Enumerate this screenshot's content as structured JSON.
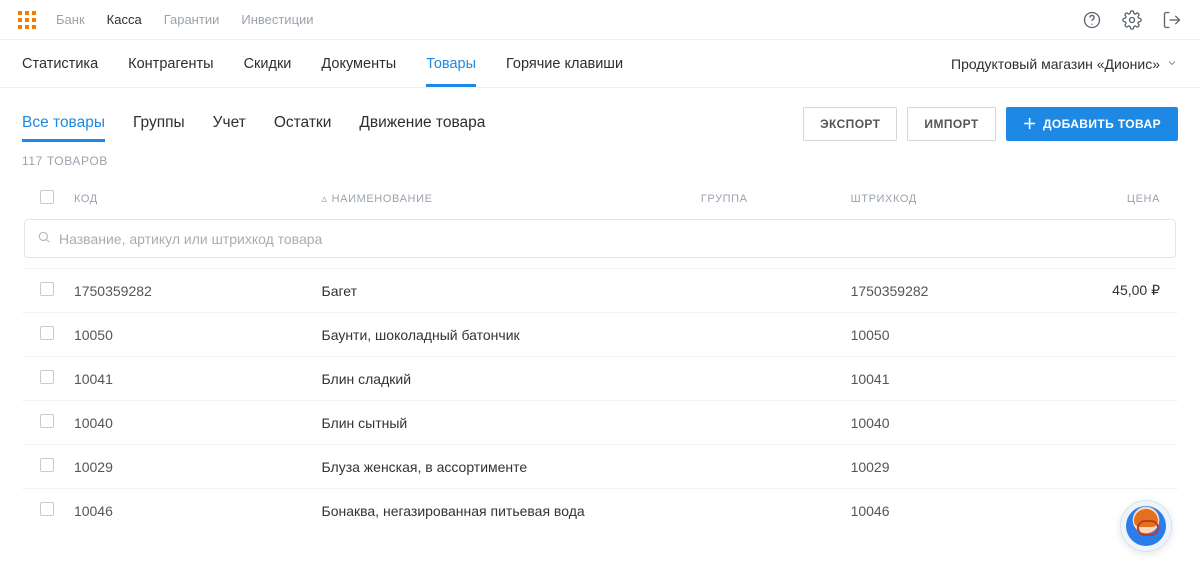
{
  "top_nav": {
    "items": [
      "Банк",
      "Касса",
      "Гарантии",
      "Инвестиции"
    ],
    "active_index": 1
  },
  "sub_nav": {
    "items": [
      "Статистика",
      "Контрагенты",
      "Скидки",
      "Документы",
      "Товары",
      "Горячие клавиши"
    ],
    "active_index": 4
  },
  "store_selector": {
    "label": "Продуктовый магазин «Дионис»"
  },
  "inner_tabs": {
    "items": [
      "Все товары",
      "Группы",
      "Учет",
      "Остатки",
      "Движение товара"
    ],
    "active_index": 0
  },
  "buttons": {
    "export": "ЭКСПОРТ",
    "import": "ИМПОРТ",
    "add": "ДОБАВИТЬ ТОВАР"
  },
  "count_label": "117 ТОВАРОВ",
  "columns": {
    "code": "КОД",
    "name": "НАИМЕНОВАНИЕ",
    "group": "ГРУППА",
    "barcode": "ШТРИХКОД",
    "price": "ЦЕНА"
  },
  "search": {
    "placeholder": "Название, артикул или штрихкод товара"
  },
  "currency": "₽",
  "rows": [
    {
      "code": "1750359282",
      "name": "Багет",
      "group": "",
      "barcode": "1750359282",
      "price": "45,00"
    },
    {
      "code": "10050",
      "name": "Баунти, шоколадный батончик",
      "group": "",
      "barcode": "10050",
      "price": ""
    },
    {
      "code": "10041",
      "name": "Блин сладкий",
      "group": "",
      "barcode": "10041",
      "price": ""
    },
    {
      "code": "10040",
      "name": "Блин сытный",
      "group": "",
      "barcode": "10040",
      "price": ""
    },
    {
      "code": "10029",
      "name": "Блуза женская, в ассортименте",
      "group": "",
      "barcode": "10029",
      "price": ""
    },
    {
      "code": "10046",
      "name": "Бонаква, негазированная питьевая вода",
      "group": "",
      "barcode": "10046",
      "price": ""
    }
  ]
}
